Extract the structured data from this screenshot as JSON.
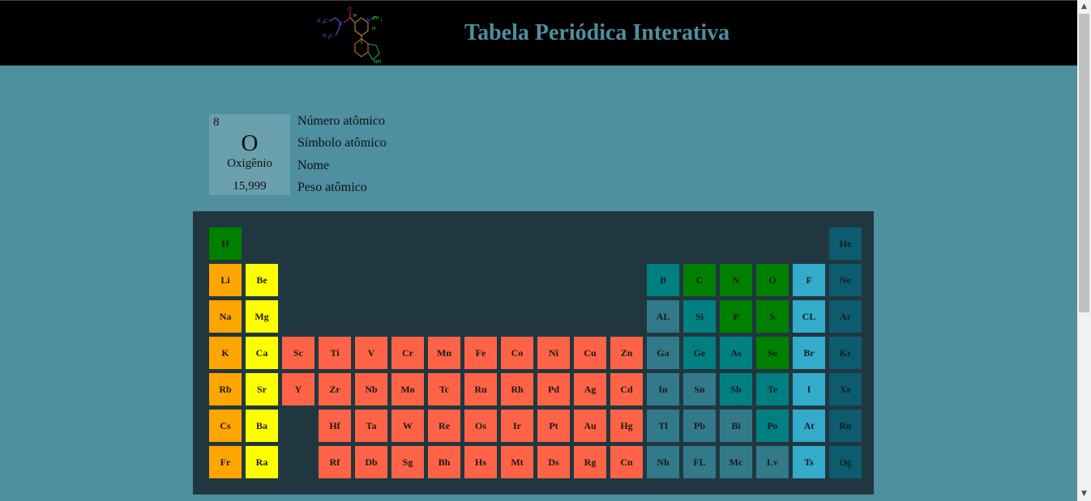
{
  "header": {
    "title": "Tabela Periódica Interativa",
    "logo_icon": "lsd-molecule-icon"
  },
  "legend": {
    "sample": {
      "number": "8",
      "symbol": "O",
      "name": "Oxigênio",
      "weight": "15,999"
    },
    "labels": [
      "Número atômico",
      "Símbolo atômico",
      "Nome",
      "Peso atômico"
    ]
  },
  "colors": {
    "nonmetal": "#008000",
    "noble_gas": "#0c5b6e",
    "alkali": "#ffa500",
    "alkaline_earth": "#ffff00",
    "transition": "#ff6347",
    "post_transition": "#32798a",
    "metalloid": "#008080",
    "halogen": "#33abcb",
    "background": "#4e8fa0",
    "panel": "#213740"
  },
  "elements": {
    "H": "H",
    "He": "He",
    "Li": "Li",
    "Be": "Be",
    "B": "B",
    "C": "C",
    "N": "N",
    "O": "O",
    "F": "F",
    "Ne": "Ne",
    "Na": "Na",
    "Mg": "Mg",
    "Al": "AL",
    "Si": "Si",
    "P": "P",
    "S": "S",
    "Cl": "CL",
    "Ar": "Ar",
    "K": "K",
    "Ca": "Ca",
    "Sc": "Sc",
    "Ti": "Ti",
    "V": "V",
    "Cr": "Cr",
    "Mn": "Mn",
    "Fe": "Fe",
    "Co": "Co",
    "Ni": "Ni",
    "Cu": "Cu",
    "Zn": "Zn",
    "Ga": "Ga",
    "Ge": "Ge",
    "As": "As",
    "Se": "Se",
    "Br": "Br",
    "Kr": "Kr",
    "Rb": "Rb",
    "Sr": "Sr",
    "Y": "Y",
    "Zr": "Zr",
    "Nb": "Nb",
    "Mo": "Mo",
    "Tc": "Tc",
    "Ru": "Ru",
    "Rh": "Rh",
    "Pd": "Pd",
    "Ag": "Ag",
    "Cd": "Cd",
    "In": "In",
    "Sn": "Sn",
    "Sb": "Sb",
    "Te": "Te",
    "I": "I",
    "Xe": "Xe",
    "Cs": "Cs",
    "Ba": "Ba",
    "Hf": "Hf",
    "Ta": "Ta",
    "W": "W",
    "Re": "Re",
    "Os": "Os",
    "Ir": "Ir",
    "Pt": "Pt",
    "Au": "Au",
    "Hg": "Hg",
    "Tl": "Tl",
    "Pb": "Pb",
    "Bi": "Bi",
    "Po": "Po",
    "At": "At",
    "Rn": "Rn",
    "Fr": "Fr",
    "Ra": "Ra",
    "Rf": "Rf",
    "Db": "Db",
    "Sg": "Sg",
    "Bh": "Bh",
    "Hs": "Hs",
    "Mt": "Mt",
    "Ds": "Ds",
    "Rg": "Rg",
    "Cn": "Cn",
    "Nh": "Nh",
    "Fl": "FL",
    "Mc": "Mc",
    "Lv": "Lv",
    "Ts": "Ts",
    "Og": "Og"
  }
}
